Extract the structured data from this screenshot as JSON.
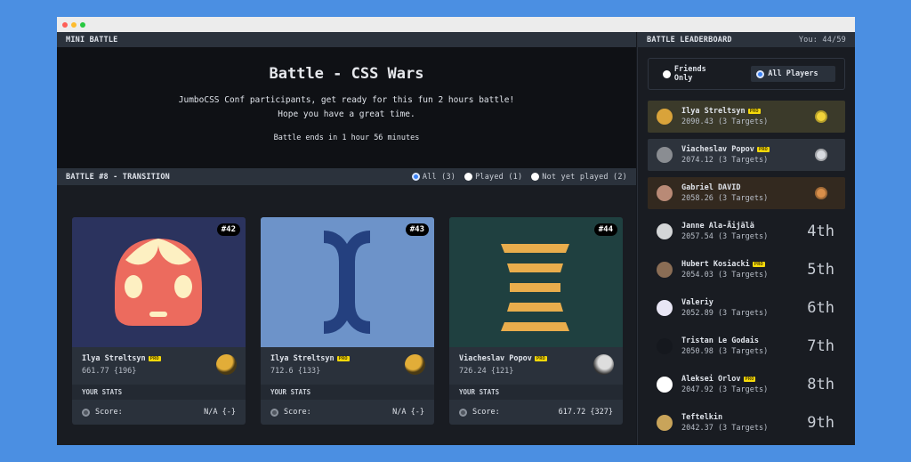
{
  "window": {
    "controls": [
      "close",
      "minimize",
      "maximize"
    ]
  },
  "left": {
    "header": "MINI BATTLE",
    "hero": {
      "title": "Battle - CSS Wars",
      "description": "JumboCSS Conf participants, get ready for this fun 2 hours battle! Hope you have a great time.",
      "ends": "Battle ends in 1 hour 56 minutes"
    },
    "battle_bar": {
      "title": "BATTLE #8 - TRANSITION",
      "filters": [
        {
          "label": "All (3)",
          "selected": true
        },
        {
          "label": "Played (1)",
          "selected": false
        },
        {
          "label": "Not yet played (2)",
          "selected": false
        }
      ]
    },
    "cards": [
      {
        "number": "#42",
        "author": "Ilya Streltsyn",
        "badge": "PRO",
        "score": "661.77 {196}",
        "stats_label": "YOUR STATS",
        "score_label": "Score:",
        "your_score": "N/A {-}",
        "bg": "#2b335e"
      },
      {
        "number": "#43",
        "author": "Ilya Streltsyn",
        "badge": "PRO",
        "score": "712.6 {133}",
        "stats_label": "YOUR STATS",
        "score_label": "Score:",
        "your_score": "N/A {-}",
        "bg": "#6d93c9"
      },
      {
        "number": "#44",
        "author": "Viacheslav Popov",
        "badge": "PRO",
        "score": "726.24 {121}",
        "stats_label": "YOUR STATS",
        "score_label": "Score:",
        "your_score": "617.72 {327}",
        "bg": "#1f4040"
      }
    ]
  },
  "leaderboard": {
    "header": "BATTLE LEADERBOARD",
    "you": "You: 44/59",
    "filters": [
      {
        "label": "Friends Only",
        "selected": false
      },
      {
        "label": "All Players",
        "selected": true
      }
    ],
    "rows": [
      {
        "name": "Ilya Streltsyn",
        "pro": "PRO",
        "score": "2090.43 (3 Targets)",
        "medal": "gold",
        "rank": ""
      },
      {
        "name": "Viacheslav Popov",
        "pro": "PRO",
        "score": "2074.12 (3 Targets)",
        "medal": "silver",
        "rank": ""
      },
      {
        "name": "Gabriel DAVID",
        "pro": "",
        "score": "2058.26 (3 Targets)",
        "medal": "bronze",
        "rank": ""
      },
      {
        "name": "Janne Ala-Äijälä",
        "pro": "",
        "score": "2057.54 (3 Targets)",
        "medal": "",
        "rank": "4th"
      },
      {
        "name": "Hubert Kosiacki",
        "pro": "PRO",
        "score": "2054.03 (3 Targets)",
        "medal": "",
        "rank": "5th"
      },
      {
        "name": "Valeriy",
        "pro": "",
        "score": "2052.89 (3 Targets)",
        "medal": "",
        "rank": "6th"
      },
      {
        "name": "Tristan Le Godais",
        "pro": "",
        "score": "2050.98 (3 Targets)",
        "medal": "",
        "rank": "7th"
      },
      {
        "name": "Aleksei Orlov",
        "pro": "PRO",
        "score": "2047.92 (3 Targets)",
        "medal": "",
        "rank": "8th"
      },
      {
        "name": "Teftelkin",
        "pro": "",
        "score": "2042.37 (3 Targets)",
        "medal": "",
        "rank": "9th"
      }
    ]
  }
}
